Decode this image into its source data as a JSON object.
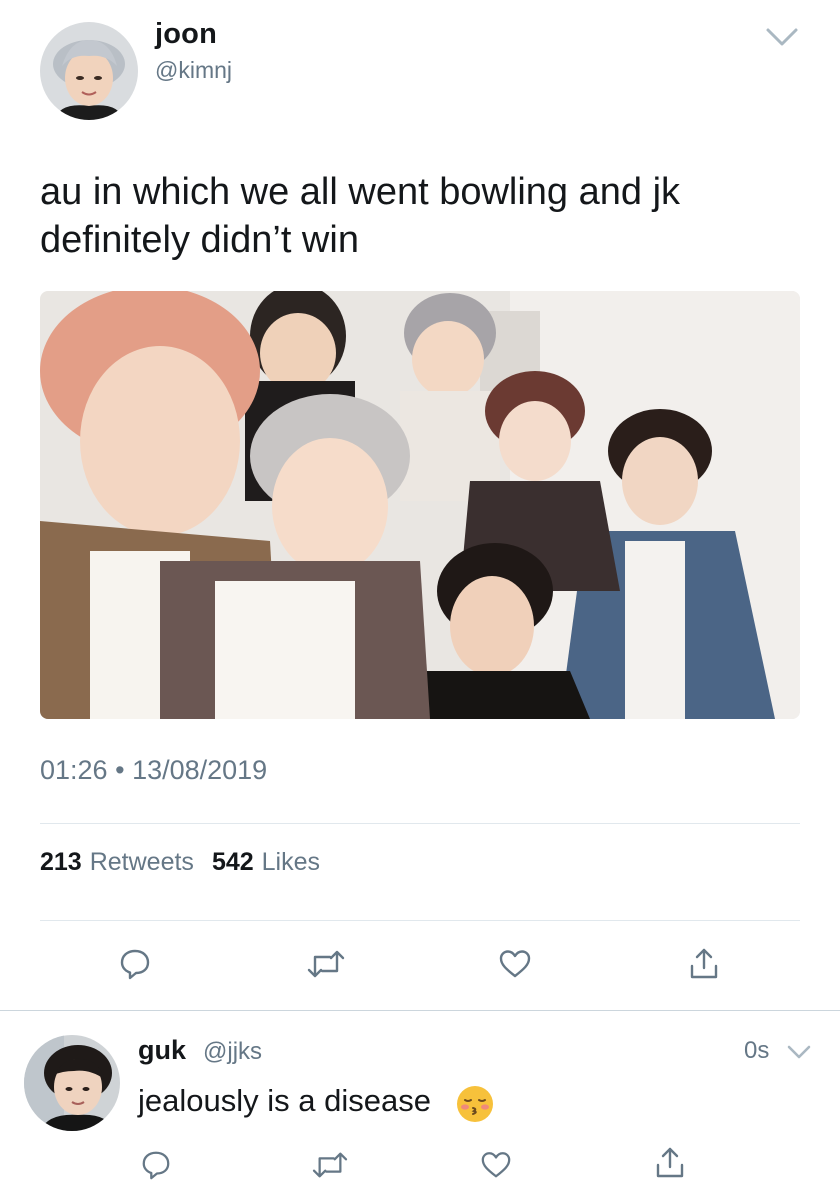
{
  "tweet": {
    "display_name": "joon",
    "handle": "@kimnj",
    "text": "au in which we all went bowling and jk definitely didn’t win",
    "time": "01:26",
    "separator": "•",
    "date": "13/08/2019",
    "retweets_count": "213",
    "retweets_label": "Retweets",
    "likes_count": "542",
    "likes_label": "Likes",
    "icons": [
      "reply-icon",
      "retweet-icon",
      "like-icon",
      "share-icon"
    ]
  },
  "reply": {
    "display_name": "guk",
    "handle": "@jjks",
    "time": "0s",
    "text": "jealously is a disease",
    "emoji": "kissing-face-with-closed-eyes",
    "icons": [
      "reply-icon",
      "retweet-icon",
      "like-icon",
      "share-icon"
    ]
  },
  "colors": {
    "text_primary": "#14171a",
    "text_secondary": "#657786",
    "divider": "#e1e8ed",
    "icon": "#657786"
  }
}
